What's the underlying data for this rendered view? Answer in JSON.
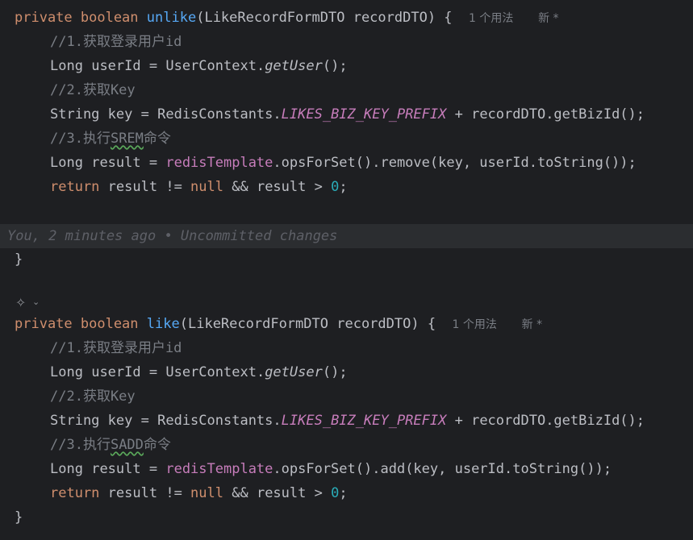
{
  "annotations": {
    "usage_hint": "1 个用法",
    "new_hint": "新 *",
    "blame_text": "You, 2 minutes ago • Uncommitted changes"
  },
  "code": {
    "unlike_method": {
      "modifiers": "private boolean",
      "name": "unlike",
      "param_type": "LikeRecordFormDTO",
      "param_name": "recordDTO",
      "comment1": "//1.获取登录用户id",
      "comment2": "//2.获取Key",
      "comment3_prefix": "//3.执行",
      "comment3_cmd": "SREM",
      "comment3_suffix": "命令",
      "op": "remove"
    },
    "like_method": {
      "modifiers": "private boolean",
      "name": "like",
      "param_type": "LikeRecordFormDTO",
      "param_name": "recordDTO",
      "comment1": "//1.获取登录用户id",
      "comment2": "//2.获取Key",
      "comment3_prefix": "//3.执行",
      "comment3_cmd": "SADD",
      "comment3_suffix": "命令",
      "op": "add"
    },
    "tokens": {
      "type_long": "Long",
      "var_userId": "userId",
      "user_context": "UserContext",
      "get_user": "getUser",
      "type_string": "String",
      "var_key": "key",
      "redis_constants": "RedisConstants",
      "likes_prefix": "LIKES_BIZ_KEY_PREFIX",
      "get_biz_id": "recordDTO.getBizId();",
      "var_result": "result",
      "redis_template": "redisTemplate",
      "ops_for_set": ".opsForSet().",
      "to_string_tail": "(key, userId.toString());",
      "kw_return": "return",
      "kw_null": "null",
      "num_zero": "0"
    }
  },
  "icons": {
    "gutter": "ai-assistant-icon",
    "chevron": "chevron-down-icon"
  }
}
